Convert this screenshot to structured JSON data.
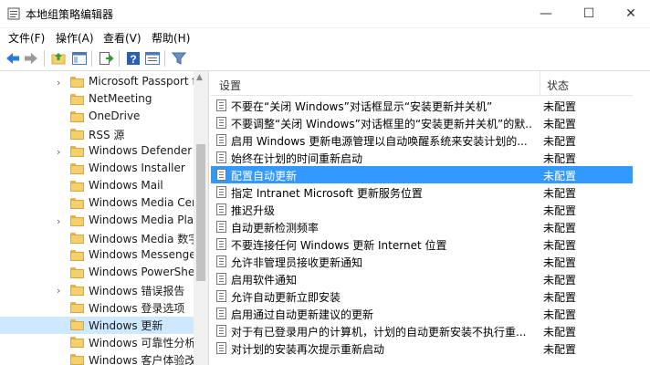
{
  "window": {
    "title": "本地组策略编辑器",
    "minimize": "—",
    "maximize": "☐",
    "close": "✕"
  },
  "menu": [
    "文件(F)",
    "操作(A)",
    "查看(V)",
    "帮助(H)"
  ],
  "toolbar": [
    "back-icon",
    "forward-icon",
    "up-folder-icon",
    "show-hide-tree-icon",
    "export-icon",
    "help-icon",
    "properties-icon",
    "filter-icon"
  ],
  "tree": {
    "items": [
      {
        "label": "Microsoft Passport fo",
        "chev": "›"
      },
      {
        "label": "NetMeeting",
        "chev": ""
      },
      {
        "label": "OneDrive",
        "chev": ""
      },
      {
        "label": "RSS 源",
        "chev": ""
      },
      {
        "label": "Windows Defender",
        "chev": "›"
      },
      {
        "label": "Windows Installer",
        "chev": ""
      },
      {
        "label": "Windows Mail",
        "chev": ""
      },
      {
        "label": "Windows Media Cen",
        "chev": ""
      },
      {
        "label": "Windows Media Play",
        "chev": "›"
      },
      {
        "label": "Windows Media 数字",
        "chev": ""
      },
      {
        "label": "Windows Messenger",
        "chev": ""
      },
      {
        "label": "Windows PowerShell",
        "chev": ""
      },
      {
        "label": "Windows 错误报告",
        "chev": "›"
      },
      {
        "label": "Windows 登录选项",
        "chev": ""
      },
      {
        "label": "Windows 更新",
        "chev": ""
      },
      {
        "label": "Windows 可靠性分析",
        "chev": ""
      },
      {
        "label": "Windows 客户体验改",
        "chev": ""
      }
    ],
    "selected_index": 14
  },
  "list": {
    "columns": {
      "setting": "设置",
      "state": "状态"
    },
    "rows": [
      {
        "label": "不要在“关闭 Windows”对话框显示“安装更新并关机”",
        "state": "未配置"
      },
      {
        "label": "不要调整“关闭 Windows”对话框里的“安装更新并关机”的默...",
        "state": "未配置"
      },
      {
        "label": "启用 Windows 更新电源管理以自动唤醒系统来安装计划的...",
        "state": "未配置"
      },
      {
        "label": "始终在计划的时间重新启动",
        "state": "未配置"
      },
      {
        "label": "配置自动更新",
        "state": "未配置"
      },
      {
        "label": "指定 Intranet Microsoft 更新服务位置",
        "state": "未配置"
      },
      {
        "label": "推迟升级",
        "state": "未配置"
      },
      {
        "label": "自动更新检测频率",
        "state": "未配置"
      },
      {
        "label": "不要连接任何 Windows 更新 Internet 位置",
        "state": "未配置"
      },
      {
        "label": "允许非管理员接收更新通知",
        "state": "未配置"
      },
      {
        "label": "启用软件通知",
        "state": "未配置"
      },
      {
        "label": "允许自动更新立即安装",
        "state": "未配置"
      },
      {
        "label": "启用通过自动更新建议的更新",
        "state": "未配置"
      },
      {
        "label": "对于有已登录用户的计算机，计划的自动更新安装不执行重...",
        "state": "未配置"
      },
      {
        "label": "对计划的安装再次提示重新启动",
        "state": "未配置"
      }
    ],
    "selected_index": 4
  },
  "colors": {
    "selection": "#3399ff",
    "tree_selection": "#cde8ff"
  }
}
